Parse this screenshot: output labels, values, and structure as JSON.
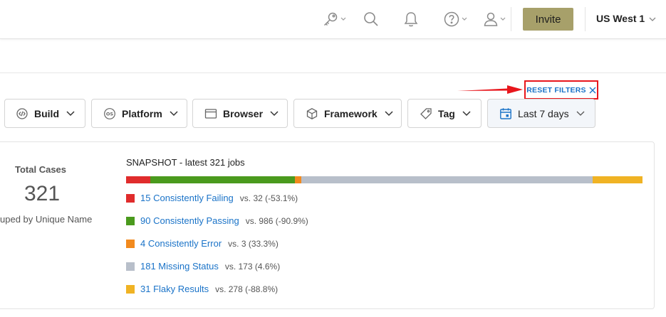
{
  "topbar": {
    "icons": [
      "key-icon",
      "search-icon",
      "bell-icon",
      "help-icon",
      "user-icon"
    ],
    "invite_label": "Invite",
    "region_label": "US West 1"
  },
  "reset_filters": {
    "label": "RESET FILTERS"
  },
  "filters": [
    {
      "label": "Build",
      "icon": "build-icon"
    },
    {
      "label": "Platform",
      "icon": "os-icon"
    },
    {
      "label": "Browser",
      "icon": "browser-window-icon"
    },
    {
      "label": "Framework",
      "icon": "cube-icon"
    },
    {
      "label": "Tag",
      "icon": "tag-icon"
    },
    {
      "label": "Last 7 days",
      "icon": "calendar-icon"
    }
  ],
  "summary": {
    "total_title": "Total Cases",
    "total_value": "321",
    "total_sub": "uped by Unique Name"
  },
  "snapshot": {
    "title": "SNAPSHOT - latest 321 jobs",
    "segments": [
      {
        "name": "Consistently Failing",
        "count": 15,
        "color": "#e02c2c"
      },
      {
        "name": "Consistently Passing",
        "count": 90,
        "color": "#4a9a1d"
      },
      {
        "name": "Consistently Error",
        "count": 4,
        "color": "#f28a1e"
      },
      {
        "name": "Missing Status",
        "count": 181,
        "color": "#b8bfca"
      },
      {
        "name": "Flaky Results",
        "count": 31,
        "color": "#f0b324"
      }
    ],
    "legend": [
      {
        "label": "15 Consistently Failing",
        "compare": "vs. 32 (-53.1%)",
        "color": "#e02c2c"
      },
      {
        "label": "90 Consistently Passing",
        "compare": "vs. 986 (-90.9%)",
        "color": "#4a9a1d"
      },
      {
        "label": "4 Consistently Error",
        "compare": "vs. 3 (33.3%)",
        "color": "#f28a1e"
      },
      {
        "label": "181 Missing Status",
        "compare": "vs. 173 (4.6%)",
        "color": "#b8bfca"
      },
      {
        "label": "31 Flaky Results",
        "compare": "vs. 278 (-88.8%)",
        "color": "#f0b324"
      }
    ]
  }
}
